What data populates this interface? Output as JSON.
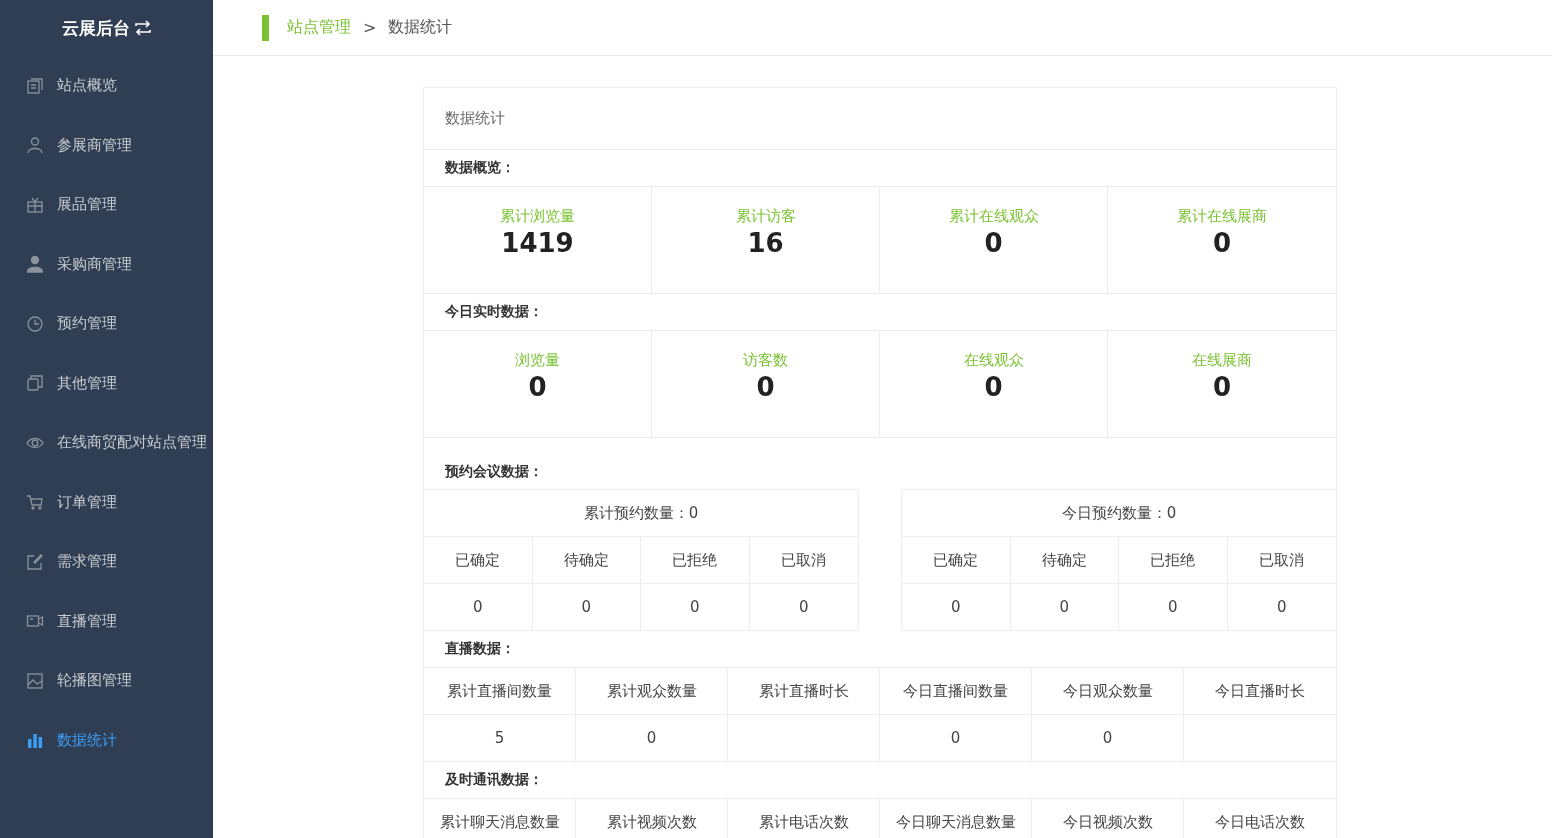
{
  "sidebar": {
    "title": "云展后台",
    "items": [
      {
        "label": "站点概览",
        "kind": "document",
        "selected": false
      },
      {
        "label": "参展商管理",
        "kind": "outline",
        "selected": false
      },
      {
        "label": "展品管理",
        "kind": "gift",
        "selected": false
      },
      {
        "label": "采购商管理",
        "kind": "person",
        "selected": false
      },
      {
        "label": "预约管理",
        "kind": "clock",
        "selected": false
      },
      {
        "label": "其他管理",
        "kind": "copy",
        "selected": false
      },
      {
        "label": "在线商贸配对站点管理",
        "kind": "eye",
        "selected": false
      },
      {
        "label": "订单管理",
        "kind": "cart",
        "selected": false
      },
      {
        "label": "需求管理",
        "kind": "edit",
        "selected": false
      },
      {
        "label": "直播管理",
        "kind": "video",
        "selected": false
      },
      {
        "label": "轮播图管理",
        "kind": "picture",
        "selected": false
      },
      {
        "label": "数据统计",
        "kind": "bars",
        "selected": true
      }
    ]
  },
  "breadcrumb": {
    "separator": ">",
    "items": [
      {
        "label": "站点管理",
        "kind": "link"
      },
      {
        "label": "数据统计",
        "kind": "current"
      }
    ]
  },
  "card": {
    "title": "数据统计",
    "overview": {
      "heading": "数据概览：",
      "stats": [
        {
          "label": "累计浏览量",
          "value": "1419"
        },
        {
          "label": "累计访客",
          "value": "16"
        },
        {
          "label": "累计在线观众",
          "value": "0"
        },
        {
          "label": "累计在线展商",
          "value": "0"
        }
      ]
    },
    "today": {
      "heading": "今日实时数据：",
      "stats": [
        {
          "label": "浏览量",
          "value": "0"
        },
        {
          "label": "访客数",
          "value": "0"
        },
        {
          "label": "在线观众",
          "value": "0"
        },
        {
          "label": "在线展商",
          "value": "0"
        }
      ]
    },
    "meetings": {
      "heading": "预约会议数据：",
      "tables": [
        {
          "summary": "累计预约数量：0",
          "columns": [
            "已确定",
            "待确定",
            "已拒绝",
            "已取消"
          ],
          "values": [
            "0",
            "0",
            "0",
            "0"
          ]
        },
        {
          "summary": "今日预约数量：0",
          "columns": [
            "已确定",
            "待确定",
            "已拒绝",
            "已取消"
          ],
          "values": [
            "0",
            "0",
            "0",
            "0"
          ]
        }
      ]
    },
    "live": {
      "heading": "直播数据：",
      "columns": [
        {
          "header": "累计直播间数量",
          "value": "5"
        },
        {
          "header": "累计观众数量",
          "value": "0"
        },
        {
          "header": "累计直播时长"
        },
        {
          "header": "今日直播间数量",
          "value": "0"
        },
        {
          "header": "今日观众数量",
          "value": "0"
        },
        {
          "header": "今日直播时长"
        }
      ]
    },
    "im": {
      "heading": "及时通讯数据：",
      "columns": [
        "累计聊天消息数量",
        "累计视频次数",
        "累计电话次数",
        "今日聊天消息数量",
        "今日视频次数",
        "今日电话次数"
      ]
    }
  }
}
